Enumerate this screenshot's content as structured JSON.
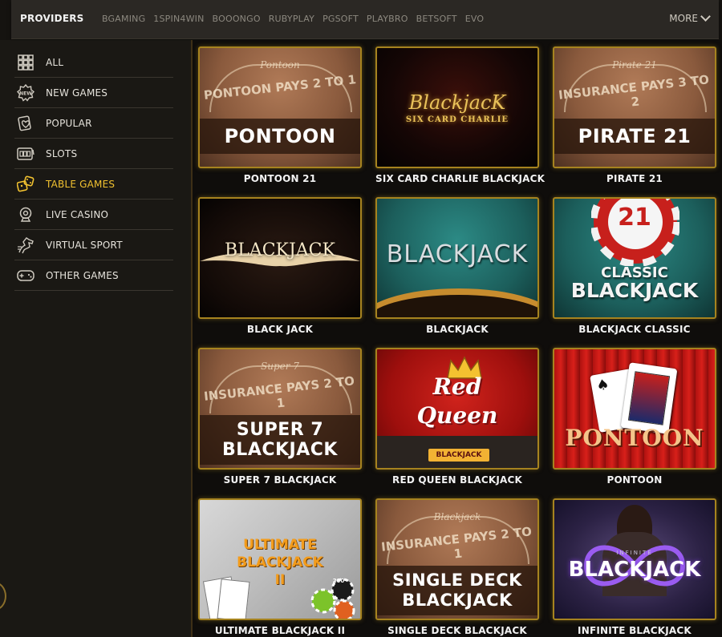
{
  "topbar": {
    "title": "PROVIDERS",
    "providers": [
      "BGAMING",
      "1SPIN4WIN",
      "BOOONGO",
      "RUBYPLAY",
      "PGSOFT",
      "PLAYBRO",
      "BETSOFT",
      "EVO"
    ],
    "more_label": "MORE"
  },
  "sidebar": {
    "items": [
      {
        "label": "ALL",
        "icon": "grid-icon",
        "active": false
      },
      {
        "label": "NEW GAMES",
        "icon": "new-badge-icon",
        "active": false
      },
      {
        "label": "POPULAR",
        "icon": "heart-card-icon",
        "active": false
      },
      {
        "label": "SLOTS",
        "icon": "slot-machine-icon",
        "active": false
      },
      {
        "label": "TABLE GAMES",
        "icon": "dice-icon",
        "active": true
      },
      {
        "label": "LIVE CASINO",
        "icon": "webcam-icon",
        "active": false
      },
      {
        "label": "VIRTUAL SPORT",
        "icon": "horse-icon",
        "active": false
      },
      {
        "label": "OTHER GAMES",
        "icon": "gamepad-icon",
        "active": false
      }
    ]
  },
  "games": [
    {
      "name": "PONTOON 21",
      "thumb_title": "PONTOON",
      "thumb_script": "Pontoon",
      "thumb_arc": "PONTOON PAYS 2 TO 1"
    },
    {
      "name": "SIX CARD CHARLIE BLACKJACK",
      "thumb_title": "BlackjacK",
      "thumb_sub": "SIX CARD CHARLIE"
    },
    {
      "name": "PIRATE 21",
      "thumb_title": "PIRATE 21",
      "thumb_script": "Pirate 21",
      "thumb_arc": "INSURANCE PAYS 3 TO 2"
    },
    {
      "name": "BLACK JACK",
      "thumb_title": "BLACKJACK"
    },
    {
      "name": "BLACKJACK",
      "thumb_title": "BLACKJACK"
    },
    {
      "name": "BLACKJACK CLASSIC",
      "thumb_title_1": "CLASSIC",
      "thumb_title_2": "BLACKJACK",
      "thumb_chip": "21"
    },
    {
      "name": "SUPER 7 BLACKJACK",
      "thumb_title_1": "SUPER 7",
      "thumb_title_2": "BLACKJACK",
      "thumb_script": "Super 7",
      "thumb_arc": "INSURANCE PAYS 2 TO 1"
    },
    {
      "name": "RED QUEEN BLACKJACK",
      "thumb_title_1": "Red",
      "thumb_title_2": "Queen",
      "thumb_sub": "BLACKJACK"
    },
    {
      "name": "PONTOON",
      "thumb_title": "PONTOON"
    },
    {
      "name": "ULTIMATE BLACKJACK II",
      "thumb_title_1": "ULTIMATE",
      "thumb_title_2": "BLACKJACK",
      "thumb_title_3": "II",
      "thumb_chip": "200"
    },
    {
      "name": "SINGLE DECK BLACKJACK",
      "thumb_title_1": "SINGLE DECK",
      "thumb_title_2": "BLACKJACK",
      "thumb_script": "Blackjack",
      "thumb_arc": "INSURANCE PAYS 2 TO 1"
    },
    {
      "name": "INFINITE BLACKJACK",
      "thumb_title": "BLACKJACK",
      "thumb_sub": "INFINITE"
    }
  ],
  "colors": {
    "accent": "#f2c230",
    "card_border": "#a6831f",
    "background": "#151310"
  }
}
